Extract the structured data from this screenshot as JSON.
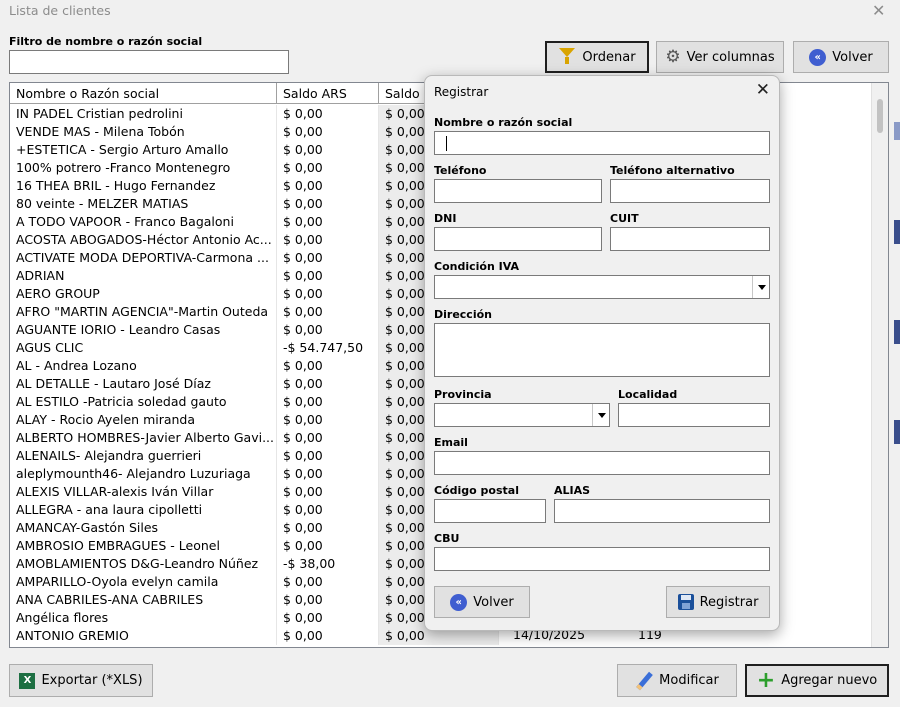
{
  "window": {
    "title": "Lista de clientes",
    "close_glyph": "✕"
  },
  "filter": {
    "label": "Filtro de nombre o razón social",
    "value": ""
  },
  "toolbar": {
    "sort_label": "Ordenar",
    "columns_label": "Ver columnas",
    "back_label": "Volver"
  },
  "table": {
    "columns": [
      "Nombre o Razón social",
      "Saldo ARS",
      "Saldo U"
    ],
    "rows": [
      [
        " IN PADEL Cristian pedrolini",
        "$ 0,00",
        "$ 0,00"
      ],
      [
        " VENDE MAS - Milena Tobón",
        "$ 0,00",
        "$ 0,00"
      ],
      [
        "+ESTETICA - Sergio Arturo Amallo",
        "$ 0,00",
        "$ 0,00"
      ],
      [
        "100% potrero -Franco Montenegro",
        "$ 0,00",
        "$ 0,00"
      ],
      [
        "16 THEA BRIL - Hugo Fernandez",
        "$ 0,00",
        "$ 0,00"
      ],
      [
        "80 veinte - MELZER MATIAS",
        "$ 0,00",
        "$ 0,00"
      ],
      [
        "A TODO VAPOOR - Franco Bagaloni",
        "$ 0,00",
        "$ 0,00"
      ],
      [
        "ACOSTA ABOGADOS-Héctor Antonio Ac...",
        "$ 0,00",
        "$ 0,00"
      ],
      [
        "ACTIVATE MODA DEPORTIVA-Carmona ...",
        "$ 0,00",
        "$ 0,00"
      ],
      [
        "ADRIAN",
        "$ 0,00",
        "$ 0,00"
      ],
      [
        "AERO GROUP",
        "$ 0,00",
        "$ 0,00"
      ],
      [
        "AFRO \"MARTIN AGENCIA\"-Martin Outeda",
        "$ 0,00",
        "$ 0,00"
      ],
      [
        "AGUANTE IORIO - Leandro Casas",
        "$ 0,00",
        "$ 0,00"
      ],
      [
        "AGUS CLIC",
        "-$ 54.747,50",
        "$ 0,00"
      ],
      [
        "AL - Andrea Lozano",
        "$ 0,00",
        "$ 0,00"
      ],
      [
        "AL DETALLE  - Lautaro José Díaz",
        "$ 0,00",
        "$ 0,00"
      ],
      [
        "AL ESTILO -Patricia soledad gauto",
        "$ 0,00",
        "$ 0,00"
      ],
      [
        "ALAY - Rocio Ayelen miranda",
        "$ 0,00",
        "$ 0,00"
      ],
      [
        "ALBERTO HOMBRES-Javier Alberto Gavi...",
        "$ 0,00",
        "$ 0,00"
      ],
      [
        "ALENAILS- Alejandra guerrieri",
        "$ 0,00",
        "$ 0,00"
      ],
      [
        "aleplymounth46- Alejandro Luzuriaga",
        "$ 0,00",
        "$ 0,00"
      ],
      [
        "ALEXIS VILLAR-alexis Iván Villar",
        "$ 0,00",
        "$ 0,00"
      ],
      [
        "ALLEGRA - ana laura cipolletti",
        "$ 0,00",
        "$ 0,00"
      ],
      [
        "AMANCAY-Gastón Siles",
        "$ 0,00",
        "$ 0,00"
      ],
      [
        "AMBROSIO EMBRAGUES -  Leonel",
        "$ 0,00",
        "$ 0,00"
      ],
      [
        "AMOBLAMIENTOS D&G-Leandro Núñez",
        "-$ 38,00",
        "$ 0,00"
      ],
      [
        "AMPARILLO-Oyola evelyn camila",
        "$ 0,00",
        "$ 0,00"
      ],
      [
        "ANA CABRILES-ANA CABRILES",
        "$ 0,00",
        "$ 0,00"
      ],
      [
        "Angélica flores",
        "$ 0,00",
        "$ 0,00"
      ],
      [
        "ANTONIO GREMIO",
        "$ 0,00",
        "$ 0,00"
      ]
    ],
    "last_row_extra": [
      "14/10/2025",
      "119"
    ]
  },
  "bottom": {
    "export_label": "Exportar (*XLS)",
    "modify_label": "Modificar",
    "add_label": "Agregar nuevo"
  },
  "dialog": {
    "title": "Registrar",
    "close_glyph": "✕",
    "labels": {
      "name": "Nombre  o razón social",
      "phone": "Teléfono",
      "alt_phone": "Teléfono alternativo",
      "dni": "DNI",
      "cuit": "CUIT",
      "iva": "Condición IVA",
      "address": "Dirección",
      "province": "Provincia",
      "locality": "Localidad",
      "email": "Email",
      "postal": "Código postal",
      "alias": "ALIAS",
      "cbu": "CBU"
    },
    "back_label": "Volver",
    "register_label": "Registrar"
  }
}
